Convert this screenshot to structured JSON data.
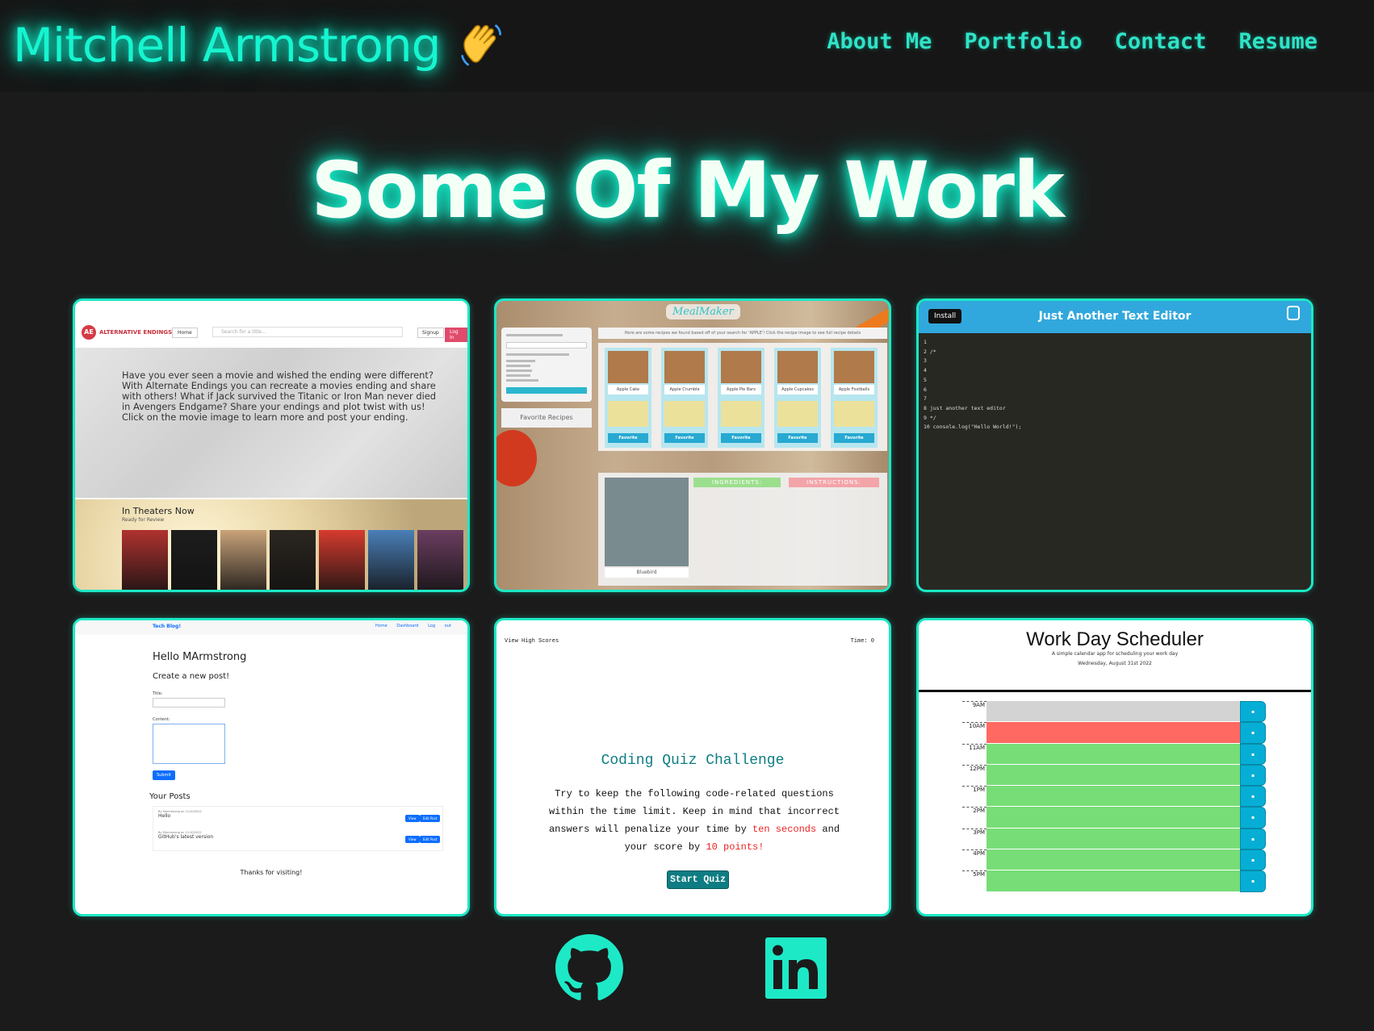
{
  "header": {
    "brand": "Mitchell Armstrong",
    "wave_icon": "waving-hand-icon",
    "nav": [
      "About Me",
      "Portfolio",
      "Contact",
      "Resume"
    ]
  },
  "page_title": "Some Of My Work",
  "colors": {
    "accent": "#1ce8c6",
    "background": "#1b1b1b",
    "nav": "#2fe3c7"
  },
  "projects": {
    "alt_endings": {
      "brand": "ALTERNATIVE ENDINGS",
      "logo": "AE",
      "home": "Home",
      "search_placeholder": "Search for a title...",
      "signup": "Signup",
      "login": "Log In",
      "hero": "Have you ever seen a movie and wished the ending were different? With Alternate Endings you can recreate a movies ending and share with others! What if Jack survived the Titanic or Iron Man never died in Avengers Endgame? Share your endings and plot twist with us! Click on the movie image to learn more and post your ending.",
      "theaters_title": "In Theaters Now",
      "theaters_sub": "Ready for Review",
      "posters": [
        "#b0322f",
        "#1d1d1d",
        "#c9a37a",
        "#2b2620",
        "#d63b2e",
        "#4a7fb8",
        "#6b3e61"
      ]
    },
    "meal_maker": {
      "title": "MealMaker",
      "results_text": "Here are some recipes we found based off of your search for 'APPLE'! Click the recipe image to see full recipe details",
      "favorites": "Favorite Recipes",
      "recipes": [
        "Apple Cake",
        "Apple Crumble",
        "Apple Pie Bars",
        "Apple Cupcakes",
        "Apple Footballs"
      ],
      "favorite_btn": "Favorite",
      "drink": "Bluebird",
      "ingredients": "INGREDIENTS:",
      "instructions": "INSTRUCTIONS:"
    },
    "jate": {
      "install": "Install",
      "title": "Just Another Text Editor",
      "logo": "JATE",
      "code": [
        "1",
        "2 /*",
        "3",
        "4",
        "5",
        "6",
        "7",
        "8 just another text editor",
        "9 */",
        "10 console.log(\"Hello World!\");"
      ]
    },
    "tech_blog": {
      "brand": "Tech Blog!",
      "links": "Home Dashboard Log out",
      "hello": "Hello MArmstrong",
      "create": "Create a new post!",
      "title_label": "Title:",
      "content_label": "Content:",
      "submit": "Submit",
      "your_posts": "Your Posts",
      "posts": [
        {
          "meta": "By MArmstrong on 11/10/2022",
          "title": "Hello"
        },
        {
          "meta": "By MArmstrong on 11/10/2022",
          "title": "GitHub's latest version"
        }
      ],
      "view": "View",
      "edit": "Edit Post",
      "thanks": "Thanks for visiting!"
    },
    "quiz": {
      "high_scores": "View High Scores",
      "time": "Time: 0",
      "title": "Coding Quiz Challenge",
      "text_1": "Try to keep the following code-related questions within the time limit. Keep in mind that incorrect answers will penalize your time by ",
      "penalty": "ten seconds",
      "text_2": " and your score by ",
      "points": "10 points!",
      "start": "Start Quiz"
    },
    "scheduler": {
      "title": "Work Day Scheduler",
      "sub": "A simple calendar app for scheduling your work day",
      "date": "Wednesday, August 31st 2022",
      "hours": [
        {
          "label": "9AM",
          "color": "#d3d3d3"
        },
        {
          "label": "10AM",
          "color": "#ff6961"
        },
        {
          "label": "11AM",
          "color": "#77dd77"
        },
        {
          "label": "12PM",
          "color": "#77dd77"
        },
        {
          "label": "1PM",
          "color": "#77dd77"
        },
        {
          "label": "2PM",
          "color": "#77dd77"
        },
        {
          "label": "3PM",
          "color": "#77dd77"
        },
        {
          "label": "4PM",
          "color": "#77dd77"
        },
        {
          "label": "5PM",
          "color": "#77dd77"
        }
      ],
      "save_icon": "save-icon"
    }
  },
  "footer": {
    "icons": [
      "github-icon",
      "linkedin-icon"
    ]
  }
}
